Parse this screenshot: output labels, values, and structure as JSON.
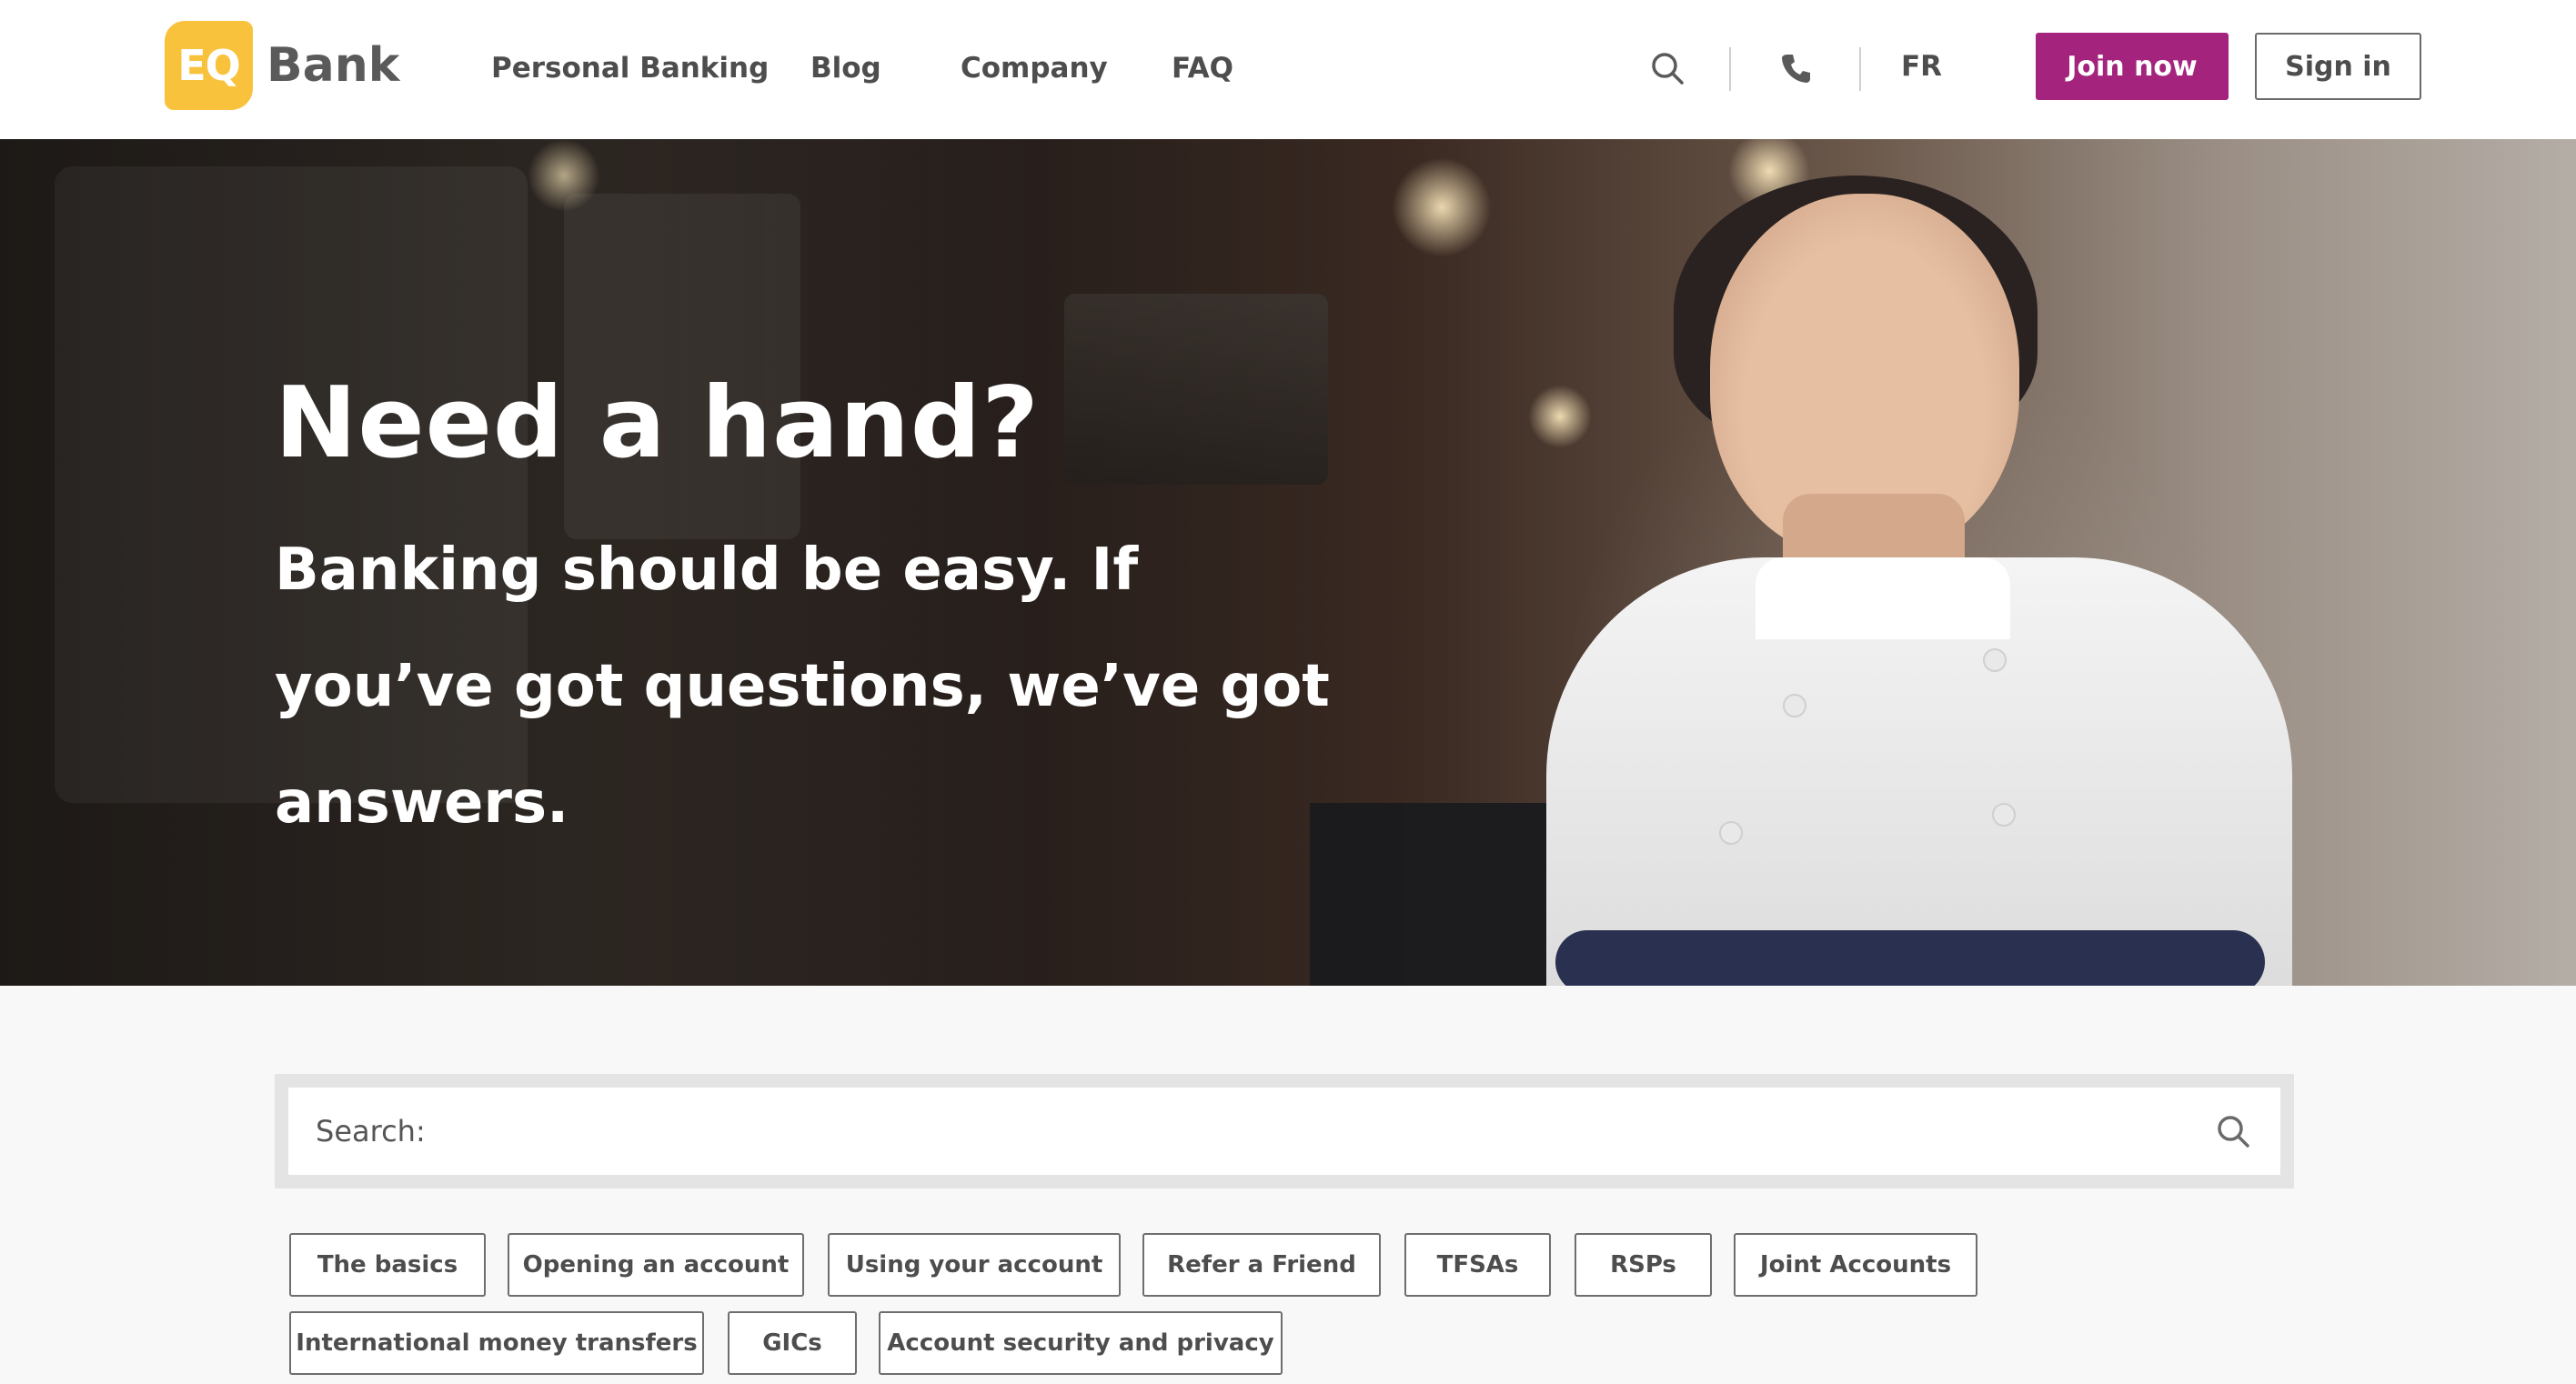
{
  "header": {
    "logo_mark": "EQ",
    "logo_word": "Bank",
    "nav": [
      {
        "label": "Personal Banking"
      },
      {
        "label": "Blog"
      },
      {
        "label": "Company"
      },
      {
        "label": "FAQ"
      }
    ],
    "search_icon": "search-icon",
    "phone_icon": "phone-icon",
    "language": "FR",
    "join_label": "Join now",
    "signin_label": "Sign in",
    "colors": {
      "accent": "#a4247d",
      "logo": "#f9c23c"
    }
  },
  "hero": {
    "title": "Need a hand?",
    "subtitle": "Banking should be easy. If you’ve got questions, we’ve got answers."
  },
  "search": {
    "placeholder": "Search:",
    "icon": "search-icon"
  },
  "topics": [
    {
      "label": "The basics"
    },
    {
      "label": "Opening an account"
    },
    {
      "label": "Using your account"
    },
    {
      "label": "Refer a Friend"
    },
    {
      "label": "TFSAs"
    },
    {
      "label": "RSPs"
    },
    {
      "label": "Joint Accounts"
    },
    {
      "label": "International money transfers"
    },
    {
      "label": "GICs"
    },
    {
      "label": "Account security and privacy"
    }
  ]
}
